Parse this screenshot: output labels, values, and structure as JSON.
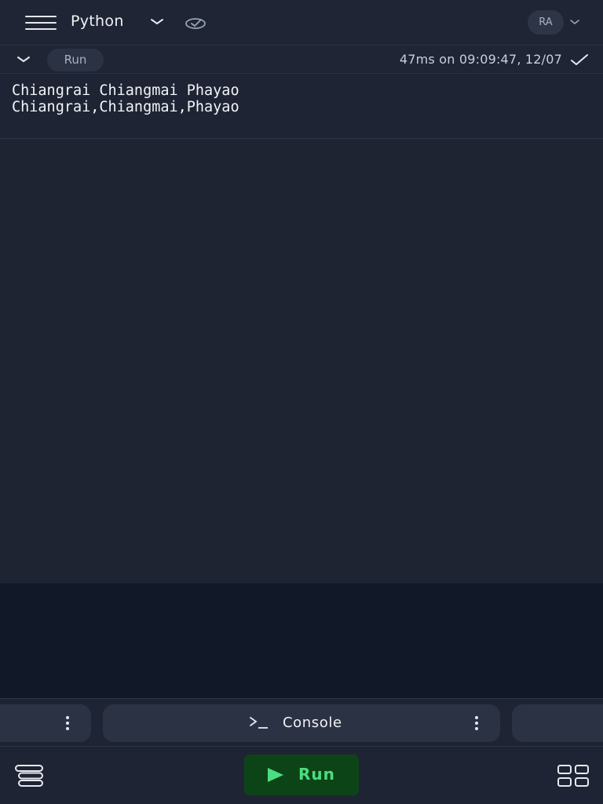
{
  "header": {
    "language": "Python",
    "user_initials": "RA"
  },
  "output_header": {
    "run_label": "Run",
    "timestamp": "47ms on 09:09:47, 12/07"
  },
  "output": {
    "lines": [
      "Chiangrai Chiangmai Phayao",
      "Chiangrai,Chiangmai,Phayao"
    ]
  },
  "panels": {
    "console_label": "Console"
  },
  "bottom": {
    "run_label": "Run"
  },
  "icons": {
    "menu": "hamburger-icon",
    "language_dropdown": "chevron-down-icon",
    "cloud": "cloud-sync-icon",
    "collapse": "chevron-down-icon",
    "status": "check-icon",
    "console": "terminal-prompt-icon",
    "options": "kebab-menu-icon",
    "files": "stack-icon",
    "play": "play-icon",
    "layout": "grid-icon"
  },
  "colors": {
    "background": "#1e2433",
    "dark_panel": "#111827",
    "run_button_bg": "#0d4417",
    "run_button_text": "#4ade80"
  }
}
